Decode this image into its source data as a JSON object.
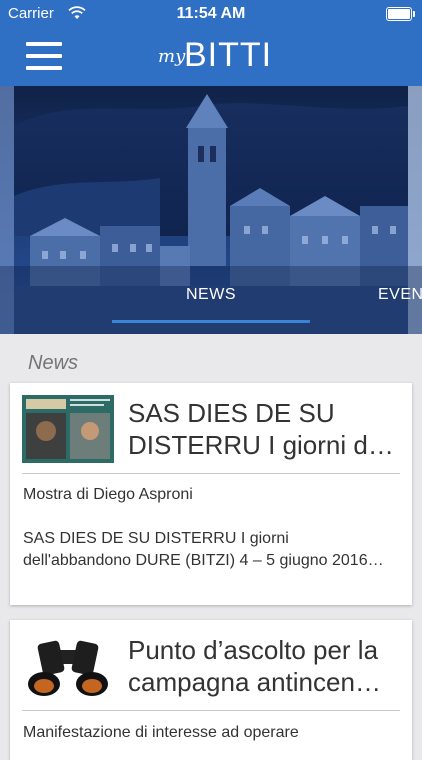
{
  "status_bar": {
    "carrier": "Carrier",
    "time": "11:54 AM"
  },
  "header": {
    "logo_my": "my",
    "logo_name": "BITTI"
  },
  "hero": {
    "tabs": [
      {
        "label": "NEWS"
      },
      {
        "label": "EVEN"
      }
    ],
    "tint_color": "#2f6fc4"
  },
  "section": {
    "title": "News"
  },
  "cards": [
    {
      "title_line1": "SAS DIES DE SU",
      "title_line2": "DISTERRU I giorni d…",
      "subtitle": "Mostra di Diego Asproni",
      "excerpt": "SAS DIES DE SU DISTERRU I giorni dell'abbandono DURE (BITZI) 4 – 5 giugno 2016…"
    },
    {
      "title_line1": "Punto d’ascolto per la",
      "title_line2": "campagna antincen…",
      "subtitle": "Manifestazione di interesse ad operare"
    }
  ],
  "colors": {
    "header": "#2f6fc4",
    "tab_indicator": "#3a84d8",
    "background": "#e9e9ec"
  }
}
